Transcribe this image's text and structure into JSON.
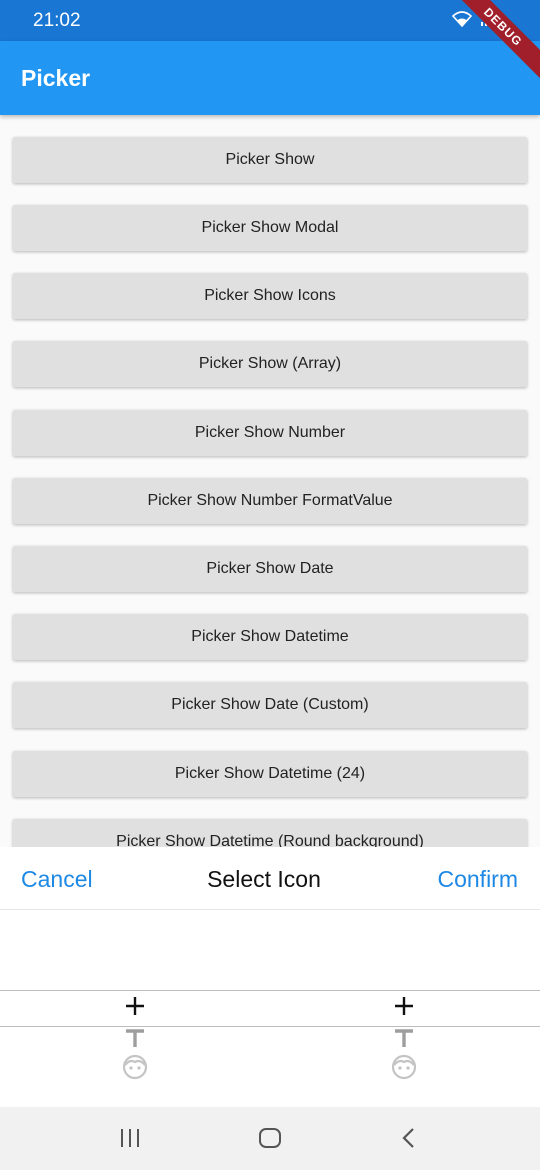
{
  "status": {
    "time": "21:02"
  },
  "debug_banner": "DEBUG",
  "appbar": {
    "title": "Picker"
  },
  "buttons": [
    "Picker Show",
    "Picker Show Modal",
    "Picker Show Icons",
    "Picker Show (Array)",
    "Picker Show Number",
    "Picker Show Number FormatValue",
    "Picker Show Date",
    "Picker Show Datetime",
    "Picker Show Date (Custom)",
    "Picker Show Datetime (24)",
    "Picker Show Datetime (Round background)"
  ],
  "sheet": {
    "cancel": "Cancel",
    "title": "Select Icon",
    "confirm": "Confirm"
  },
  "picker_columns": [
    {
      "items": [
        "add-icon",
        "title-icon",
        "face-icon"
      ]
    },
    {
      "items": [
        "add-icon",
        "title-icon",
        "face-icon"
      ]
    }
  ],
  "colors": {
    "primary": "#2196f3",
    "primary_dark": "#1976d2",
    "accent": "#1e88e5",
    "button": "#e0e0e0"
  }
}
